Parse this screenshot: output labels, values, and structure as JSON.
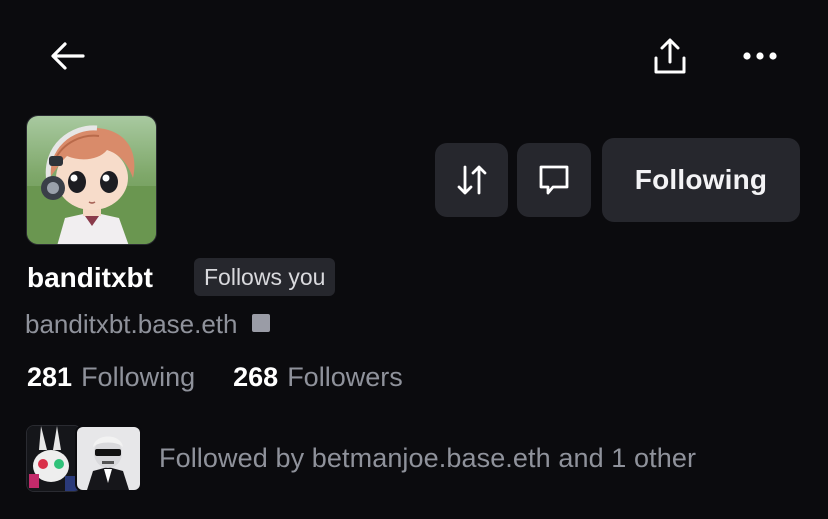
{
  "profile": {
    "username": "banditxbt",
    "follows_you_label": "Follows you",
    "handle": "banditxbt.base.eth"
  },
  "actions": {
    "follow_label": "Following"
  },
  "stats": {
    "following_count": "281",
    "following_label": "Following",
    "followers_count": "268",
    "followers_label": "Followers"
  },
  "mutuals": {
    "text": "Followed by betmanjoe.base.eth and 1 other"
  },
  "icons": {
    "back": "arrow-left-icon",
    "share": "share-icon",
    "more": "more-horizontal-icon",
    "swap": "swap-arrows-icon",
    "message": "message-icon"
  },
  "colors": {
    "background": "#0b0b0e",
    "button_bg": "#26272d",
    "muted_text": "#8f929b"
  }
}
